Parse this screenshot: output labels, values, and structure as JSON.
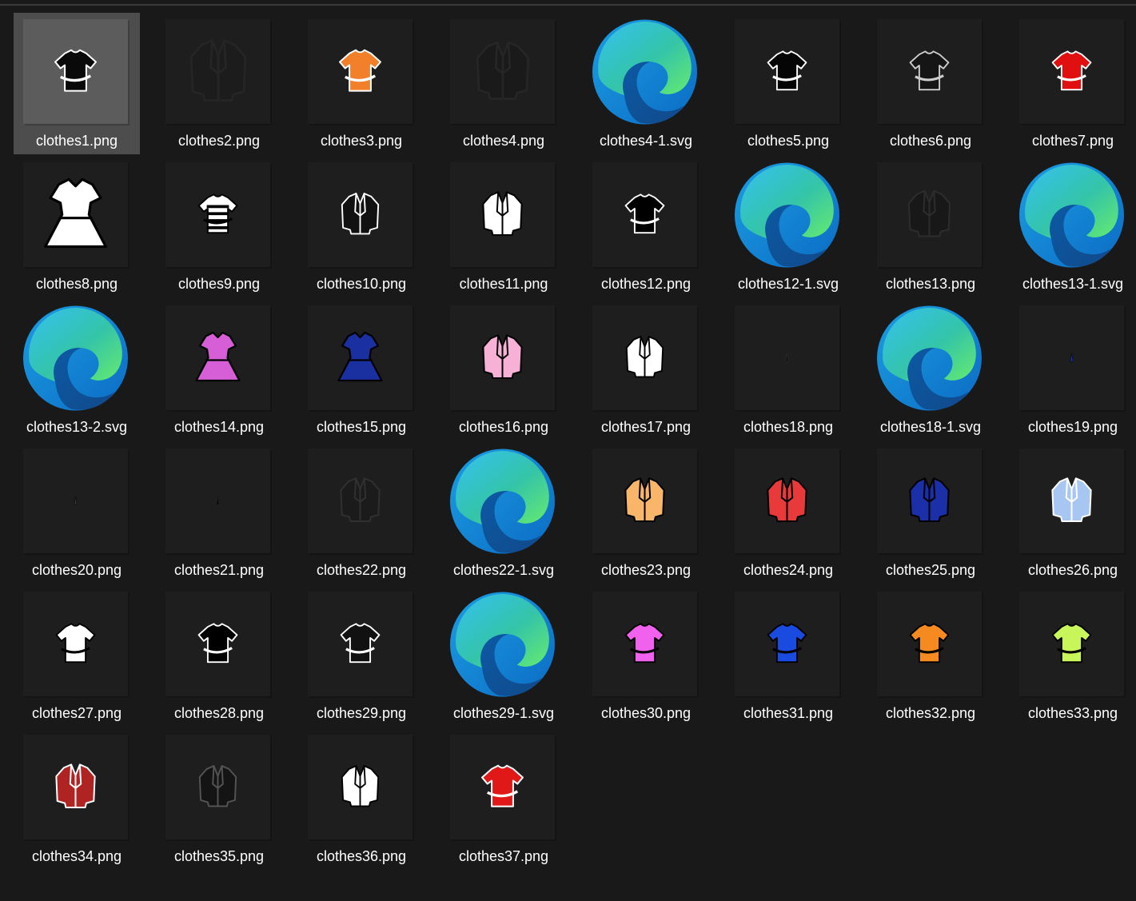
{
  "window": {
    "view": "Large icons",
    "selected_index": 0
  },
  "files": [
    {
      "name": "clothes1.png",
      "type": "png",
      "icon": "black-shirt-icon",
      "color": "#0a0a0a",
      "stroke": "#ffffff",
      "size": 0.32
    },
    {
      "name": "clothes2.png",
      "type": "png",
      "icon": "dark-jacket-icon",
      "color": "#1c1c1c",
      "stroke": "#252525",
      "size": 0.45
    },
    {
      "name": "clothes3.png",
      "type": "png",
      "icon": "orange-shirt-icon",
      "color": "#f2802a",
      "stroke": "#ffffff",
      "size": 0.32
    },
    {
      "name": "clothes4.png",
      "type": "png",
      "icon": "dark-jacket-icon",
      "color": "#1a1a1a",
      "stroke": "#262626",
      "size": 0.42
    },
    {
      "name": "clothes4-1.svg",
      "type": "svg",
      "icon": "edge-icon"
    },
    {
      "name": "clothes5.png",
      "type": "png",
      "icon": "black-shirt-icon",
      "color": "#050505",
      "stroke": "#ffffff",
      "size": 0.3
    },
    {
      "name": "clothes6.png",
      "type": "png",
      "icon": "black-shirt-icon",
      "color": "#151515",
      "stroke": "#cccccc",
      "size": 0.3
    },
    {
      "name": "clothes7.png",
      "type": "png",
      "icon": "red-shirt-icon",
      "color": "#e01010",
      "stroke": "#ffffff",
      "size": 0.3
    },
    {
      "name": "clothes8.png",
      "type": "png",
      "icon": "white-dress-icon",
      "color": "#ffffff",
      "stroke": "#000000",
      "size": 0.5
    },
    {
      "name": "clothes9.png",
      "type": "png",
      "icon": "striped-shirt-icon",
      "color": "#ffffff",
      "stroke": "#000000",
      "size": 0.3
    },
    {
      "name": "clothes10.png",
      "type": "png",
      "icon": "suit-icon",
      "color": "#111111",
      "stroke": "#ffffff",
      "size": 0.3
    },
    {
      "name": "clothes11.png",
      "type": "png",
      "icon": "white-jacket-icon",
      "color": "#ffffff",
      "stroke": "#000000",
      "size": 0.32
    },
    {
      "name": "clothes12.png",
      "type": "png",
      "icon": "black-shirt-icon",
      "color": "#000000",
      "stroke": "#ffffff",
      "size": 0.3
    },
    {
      "name": "clothes12-1.svg",
      "type": "svg",
      "icon": "edge-icon"
    },
    {
      "name": "clothes13.png",
      "type": "png",
      "icon": "dark-jacket-icon",
      "color": "#181818",
      "stroke": "#2c2c2c",
      "size": 0.34
    },
    {
      "name": "clothes13-1.svg",
      "type": "svg",
      "icon": "edge-icon"
    },
    {
      "name": "clothes13-2.svg",
      "type": "svg",
      "icon": "edge-icon"
    },
    {
      "name": "clothes14.png",
      "type": "png",
      "icon": "pink-dress-icon",
      "color": "#d65ed6",
      "stroke": "#000000",
      "size": 0.36
    },
    {
      "name": "clothes15.png",
      "type": "png",
      "icon": "blue-dress-icon",
      "color": "#1a2fa0",
      "stroke": "#000000",
      "size": 0.36
    },
    {
      "name": "clothes16.png",
      "type": "png",
      "icon": "pink-jacket-icon",
      "color": "#f7b0d6",
      "stroke": "#000000",
      "size": 0.32
    },
    {
      "name": "clothes17.png",
      "type": "png",
      "icon": "white-jacket-icon",
      "color": "#ffffff",
      "stroke": "#000000",
      "size": 0.3
    },
    {
      "name": "clothes18.png",
      "type": "png",
      "icon": "tie-icon",
      "color": "#0d0d0d",
      "stroke": "#333333",
      "size": 0.08
    },
    {
      "name": "clothes18-1.svg",
      "type": "svg",
      "icon": "edge-icon"
    },
    {
      "name": "clothes19.png",
      "type": "png",
      "icon": "tie-icon",
      "color": "#1a35c9",
      "stroke": "#000000",
      "size": 0.08
    },
    {
      "name": "clothes20.png",
      "type": "png",
      "icon": "tie-icon",
      "color": "#3a3a3a",
      "stroke": "#000000",
      "size": 0.08
    },
    {
      "name": "clothes21.png",
      "type": "png",
      "icon": "tie-icon",
      "color": "#050505",
      "stroke": "#222222",
      "size": 0.08
    },
    {
      "name": "clothes22.png",
      "type": "png",
      "icon": "dark-jacket-icon",
      "color": "#1b1b1b",
      "stroke": "#303030",
      "size": 0.32
    },
    {
      "name": "clothes22-1.svg",
      "type": "svg",
      "icon": "edge-icon"
    },
    {
      "name": "clothes23.png",
      "type": "png",
      "icon": "orange-jacket-icon",
      "color": "#f9b56a",
      "stroke": "#000000",
      "size": 0.32
    },
    {
      "name": "clothes24.png",
      "type": "png",
      "icon": "red-jacket-icon",
      "color": "#e83a3a",
      "stroke": "#000000",
      "size": 0.32
    },
    {
      "name": "clothes25.png",
      "type": "png",
      "icon": "blue-jacket-icon",
      "color": "#1a2fa8",
      "stroke": "#000000",
      "size": 0.32
    },
    {
      "name": "clothes26.png",
      "type": "png",
      "icon": "light-blue-jacket-icon",
      "color": "#a8c6f2",
      "stroke": "#ffffff",
      "size": 0.32
    },
    {
      "name": "clothes27.png",
      "type": "png",
      "icon": "white-shirt-icon",
      "color": "#ffffff",
      "stroke": "#000000",
      "size": 0.3
    },
    {
      "name": "clothes28.png",
      "type": "png",
      "icon": "black-shirt-icon",
      "color": "#000000",
      "stroke": "#ffffff",
      "size": 0.3
    },
    {
      "name": "clothes29.png",
      "type": "png",
      "icon": "black-shirt-icon",
      "color": "#111111",
      "stroke": "#ffffff",
      "size": 0.3
    },
    {
      "name": "clothes29-1.svg",
      "type": "svg",
      "icon": "edge-icon"
    },
    {
      "name": "clothes30.png",
      "type": "png",
      "icon": "pink-shirt-icon",
      "color": "#f062ee",
      "stroke": "#000000",
      "size": 0.3
    },
    {
      "name": "clothes31.png",
      "type": "png",
      "icon": "blue-shirt-icon",
      "color": "#1a4be0",
      "stroke": "#000000",
      "size": 0.3
    },
    {
      "name": "clothes32.png",
      "type": "png",
      "icon": "orange-shirt-icon",
      "color": "#f58a20",
      "stroke": "#000000",
      "size": 0.3
    },
    {
      "name": "clothes33.png",
      "type": "png",
      "icon": "lime-shirt-icon",
      "color": "#c8f55a",
      "stroke": "#000000",
      "size": 0.3
    },
    {
      "name": "clothes34.png",
      "type": "png",
      "icon": "varsity-jacket-icon",
      "color": "#b02323",
      "stroke": "#ffffff",
      "size": 0.32
    },
    {
      "name": "clothes35.png",
      "type": "png",
      "icon": "dark-jacket-icon",
      "color": "#141414",
      "stroke": "#555555",
      "size": 0.3
    },
    {
      "name": "clothes36.png",
      "type": "png",
      "icon": "white-jacket-icon",
      "color": "#ffffff",
      "stroke": "#000000",
      "size": 0.3
    },
    {
      "name": "clothes37.png",
      "type": "png",
      "icon": "red-shirt-icon",
      "color": "#e01818",
      "stroke": "#ffffff",
      "size": 0.32
    }
  ]
}
